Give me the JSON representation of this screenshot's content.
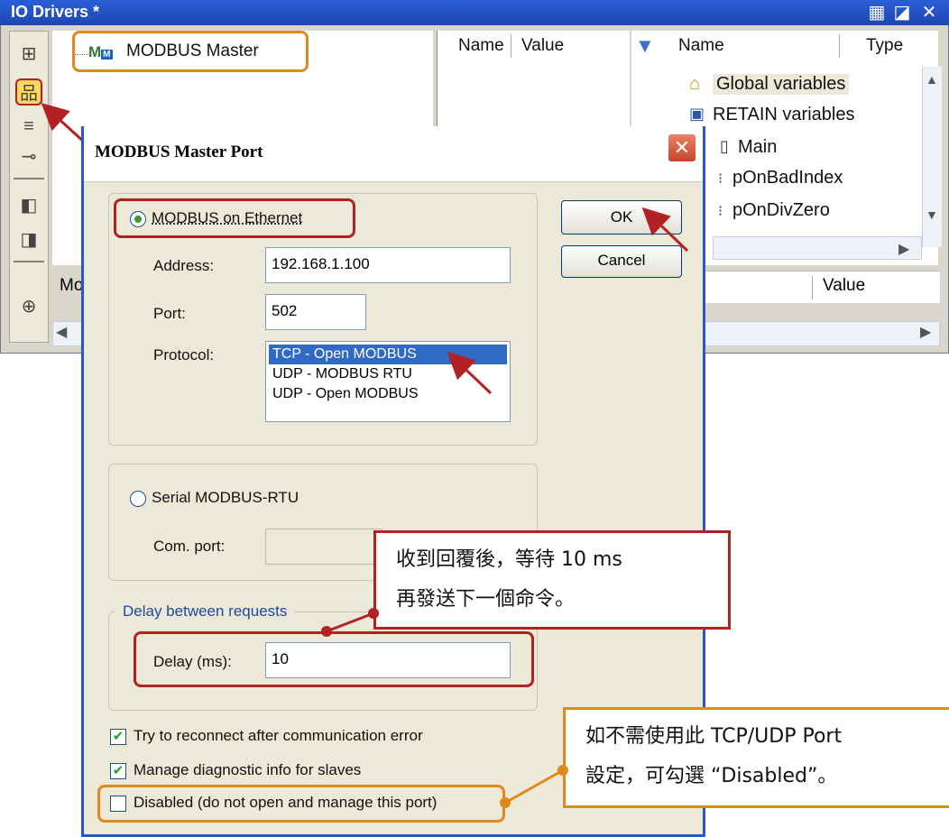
{
  "window": {
    "title": "IO Drivers *",
    "tree_item": "MODBUS Master",
    "grid_left_headers": [
      "Name",
      "Value"
    ],
    "grid_right_headers": [
      "Name",
      "Type"
    ],
    "variables": [
      "Global variables",
      "RETAIN variables",
      "Main",
      "pOnBadIndex",
      "pOnDivZero"
    ],
    "value_header": "Value",
    "lower_col_fragment": "Mo"
  },
  "dialog": {
    "title": "MODBUS Master Port",
    "ethernet": {
      "radio_label": "MODBUS on Ethernet",
      "address_label": "Address:",
      "address_value": "192.168.1.100",
      "port_label": "Port:",
      "port_value": "502",
      "protocol_label": "Protocol:",
      "protocol_options": [
        "TCP - Open MODBUS",
        "UDP - MODBUS RTU",
        "UDP - Open MODBUS"
      ],
      "protocol_selected": 0
    },
    "serial": {
      "radio_label": "Serial MODBUS-RTU",
      "com_label": "Com. port:"
    },
    "delay": {
      "group_label": "Delay between requests",
      "label": "Delay (ms):",
      "value": "10"
    },
    "buttons": {
      "ok": "OK",
      "cancel": "Cancel"
    },
    "checkboxes": [
      {
        "label": "Try to reconnect after communication error",
        "checked": true
      },
      {
        "label": "Manage diagnostic info for slaves",
        "checked": true
      },
      {
        "label": "Disabled (do not open and manage this port)",
        "checked": false
      }
    ]
  },
  "callouts": {
    "delay_line1": "收到回覆後，等待 10 ms",
    "delay_line2": "再發送下一個命令。",
    "disabled_line1": "如不需使用此 TCP/UDP Port",
    "disabled_line2": "設定，可勾選 “Disabled”。"
  },
  "colors": {
    "titlebar": "#1d47b3",
    "dialog_bg": "#ece9d8",
    "selection": "#316ac5",
    "annotation_red": "#b22222",
    "annotation_orange": "#e08a1e"
  }
}
